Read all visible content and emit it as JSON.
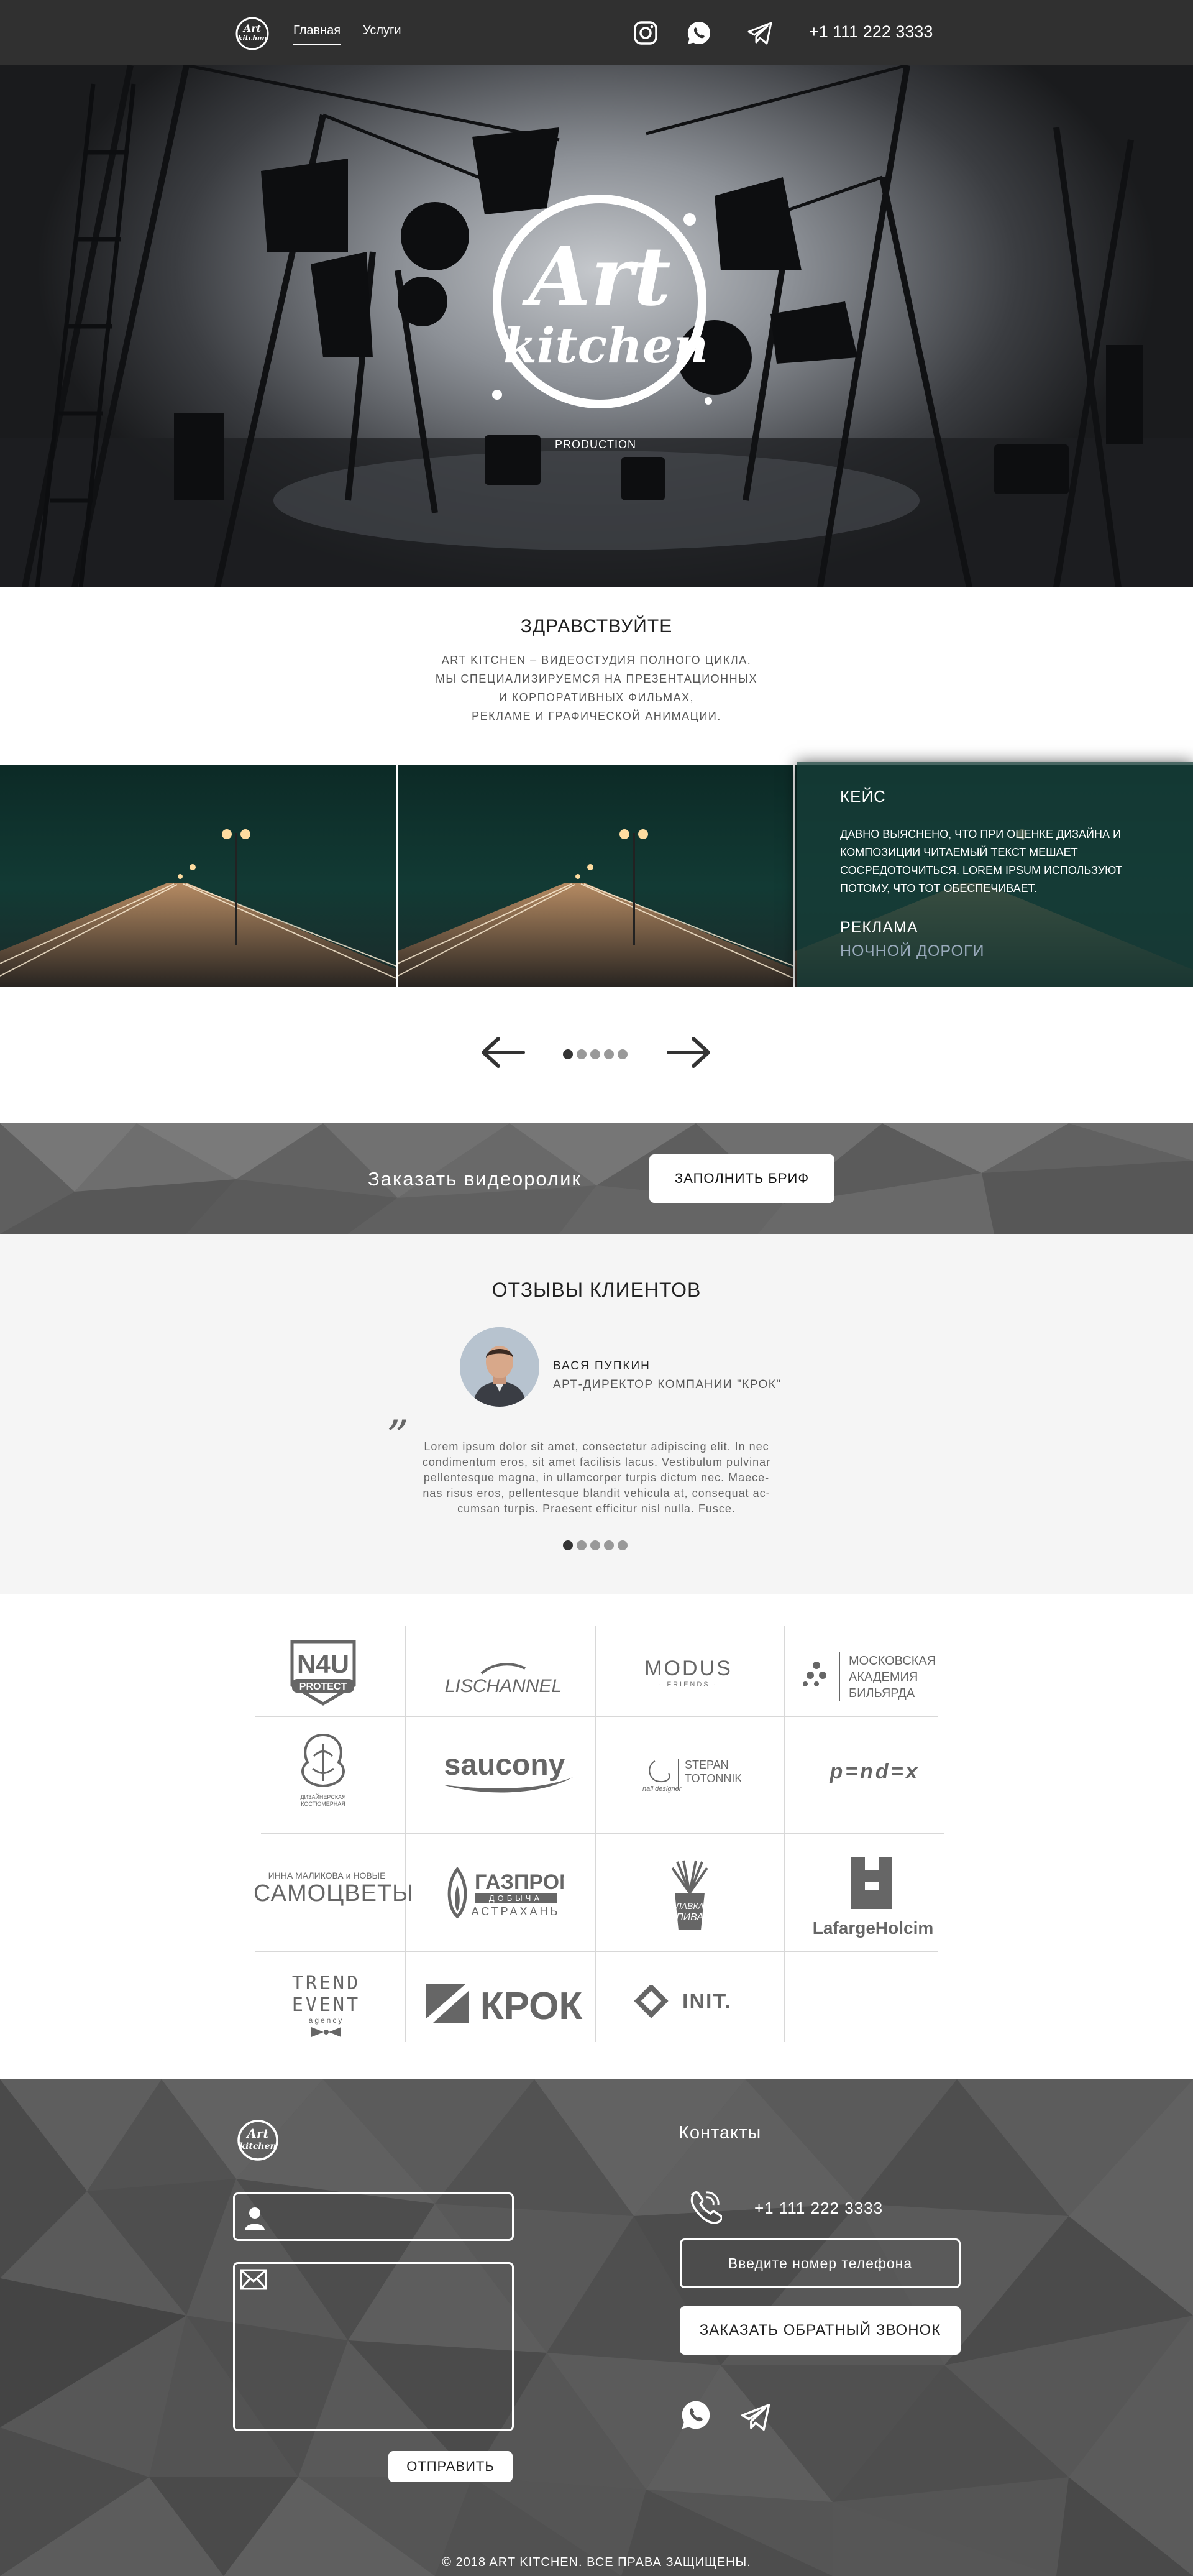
{
  "nav": {
    "home_label": "Главная",
    "services_label": "Услуги",
    "phone": "+1 111 222 3333",
    "icons": [
      "instagram-icon",
      "whatsapp-icon",
      "telegram-icon"
    ]
  },
  "brand": {
    "logo_text_line1": "Art",
    "logo_text_line2": "kitchen",
    "hero_sub": "PRODUCTION"
  },
  "intro": {
    "title": "ЗДРАВСТВУЙТЕ",
    "lines": [
      "ART KITCHEN – ВИДЕОСТУДИЯ ПОЛНОГО ЦИКЛА.",
      "МЫ СПЕЦИАЛИЗИРУЕМСЯ НА ПРЕЗЕНТАЦИОННЫХ",
      "И КОРПОРАТИВНЫХ ФИЛЬМАХ,",
      "РЕКЛАМЕ И ГРАФИЧЕСКОЙ АНИМАЦИИ."
    ]
  },
  "case": {
    "title": "КЕЙС",
    "description": "ДАВНО ВЫЯСНЕНО, ЧТО ПРИ ОЦЕНКЕ ДИЗАЙНА И КОМПОЗИЦИИ ЧИТАЕМЫЙ ТЕКСТ МЕШАЕТ СОСРЕДОТОЧИТЬСЯ. LOREM IPSUM ИСПОЛЬЗУЮТ ПОТОМУ, ЧТО ТОТ ОБЕСПЕЧИВАЕТ.",
    "tag": "РЕКЛАМА",
    "name": "НОЧНОЙ ДОРОГИ"
  },
  "cta": {
    "text": "Заказать видеоролик",
    "button": "ЗАПОЛНИТЬ БРИФ"
  },
  "reviews": {
    "title": "ОТЗЫВЫ КЛИЕНТОВ",
    "person_name": "ВАСЯ ПУПКИН",
    "person_role": "АРТ-ДИРЕКТОР КОМПАНИИ \"КРОК\"",
    "quote_mark": "”",
    "text_lines": [
      "Lorem ipsum dolor sit amet, consectetur adipiscing elit. In nec",
      "condimentum eros, sit amet facilisis lacus. Vestibulum pulvinar",
      "pellentesque magna, in ullamcorper turpis dictum nec. Maece-",
      "nas risus eros, pellentesque blandit vehicula at, consequat ac-",
      "cumsan turpis. Praesent efficitur nisl nulla. Fusce."
    ]
  },
  "clients": {
    "n4u_1": "N4U",
    "n4u_2": "PROTECT",
    "lischannel": "LISCHANNEL",
    "modus": "MODUS",
    "modus_sub": "· FRIENDS ·",
    "mab_1": "МОСКОВСКАЯ",
    "mab_2": "АКАДЕМИЯ",
    "mab_3": "БИЛЬЯРДА",
    "dk_1": "ДИЗАЙНЕРСКАЯ",
    "dk_2": "КОСТЮМЕРНАЯ",
    "saucony": "saucony",
    "stepan_1": "STEPAN",
    "stepan_2": "TOTONNIK",
    "stepan_3": "nail designer",
    "pendex": "p=nd=x",
    "samo_1": "ИННА МАЛИКОВА и НОВЫЕ",
    "samo_2": "САМОЦВЕТЫ",
    "gazprom_1": "ГАЗПРОМ",
    "gazprom_2": "ДОБЫЧА",
    "gazprom_3": "АСТРАХАНЬ",
    "beer_1": "ЛАВКА",
    "beer_2": "ПИВА",
    "lafarge": "LafargeHolcim",
    "trend_1": "TREND EVENT",
    "trend_2": "agency",
    "krok": "КРОК",
    "init": "INIT."
  },
  "footer": {
    "contacts_title": "Контакты",
    "phone": "+1 111 222 3333",
    "phone_placeholder": "Введите номер телефона",
    "callback_button": "ЗАКАЗАТЬ ОБРАТНЫЙ ЗВОНОК",
    "send_button": "ОТПРАВИТЬ",
    "copyright": "© 2018 ART KITCHEN. ВСЕ ПРАВА ЗАЩИЩЕНЫ."
  },
  "colors": {
    "nav_bg": "#303030",
    "case_overlay": "#163c37",
    "cta_bg": "#666666",
    "reviews_bg": "#f5f5f5",
    "footer_bg": "#555555"
  }
}
